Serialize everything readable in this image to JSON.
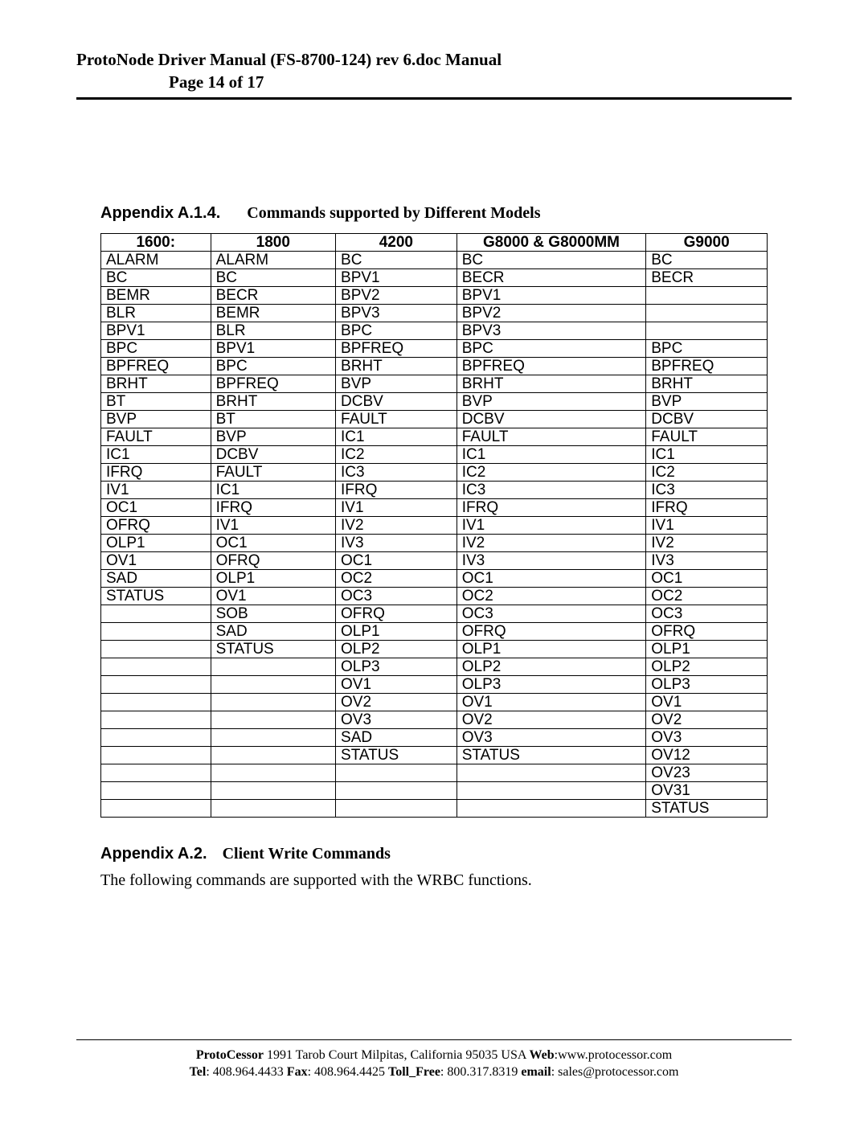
{
  "header": {
    "line1": "ProtoNode Driver Manual (FS-8700-124) rev 6.doc Manual",
    "line2": "Page 14 of 17"
  },
  "section1": {
    "number": "Appendix A.1.4.",
    "title": "Commands supported by Different Models"
  },
  "table": {
    "headers": [
      "1600:",
      "1800",
      "4200",
      "G8000 & G8000MM",
      "G9000"
    ],
    "rows": [
      [
        "ALARM",
        "ALARM",
        "BC",
        "BC",
        "BC"
      ],
      [
        "BC",
        "BC",
        "BPV1",
        "BECR",
        "BECR"
      ],
      [
        "BEMR",
        "BECR",
        "BPV2",
        "BPV1",
        ""
      ],
      [
        "BLR",
        "BEMR",
        "BPV3",
        "BPV2",
        ""
      ],
      [
        "BPV1",
        "BLR",
        "BPC",
        "BPV3",
        ""
      ],
      [
        "BPC",
        "BPV1",
        "BPFREQ",
        "BPC",
        "BPC"
      ],
      [
        "BPFREQ",
        "BPC",
        "BRHT",
        "BPFREQ",
        "BPFREQ"
      ],
      [
        "BRHT",
        "BPFREQ",
        "BVP",
        "BRHT",
        "BRHT"
      ],
      [
        "BT",
        "BRHT",
        "DCBV",
        "BVP",
        "BVP"
      ],
      [
        "BVP",
        "BT",
        "FAULT",
        "DCBV",
        "DCBV"
      ],
      [
        "FAULT",
        "BVP",
        "IC1",
        "FAULT",
        "FAULT"
      ],
      [
        "IC1",
        "DCBV",
        "IC2",
        "IC1",
        "IC1"
      ],
      [
        "IFRQ",
        "FAULT",
        "IC3",
        "IC2",
        "IC2"
      ],
      [
        "IV1",
        "IC1",
        "IFRQ",
        "IC3",
        "IC3"
      ],
      [
        "OC1",
        "IFRQ",
        "IV1",
        "IFRQ",
        "IFRQ"
      ],
      [
        "OFRQ",
        "IV1",
        "IV2",
        "IV1",
        "IV1"
      ],
      [
        "OLP1",
        "OC1",
        "IV3",
        "IV2",
        "IV2"
      ],
      [
        "OV1",
        "OFRQ",
        "OC1",
        "IV3",
        "IV3"
      ],
      [
        "SAD",
        "OLP1",
        "OC2",
        "OC1",
        "OC1"
      ],
      [
        "STATUS",
        "OV1",
        "OC3",
        "OC2",
        "OC2"
      ],
      [
        "",
        "SOB",
        "OFRQ",
        "OC3",
        "OC3"
      ],
      [
        "",
        "SAD",
        "OLP1",
        "OFRQ",
        "OFRQ"
      ],
      [
        "",
        "STATUS",
        "OLP2",
        "OLP1",
        "OLP1"
      ],
      [
        "",
        "",
        "OLP3",
        "OLP2",
        "OLP2"
      ],
      [
        "",
        "",
        "OV1",
        "OLP3",
        "OLP3"
      ],
      [
        "",
        "",
        "OV2",
        "OV1",
        "OV1"
      ],
      [
        "",
        "",
        "OV3",
        "OV2",
        "OV2"
      ],
      [
        "",
        "",
        "SAD",
        "OV3",
        "OV3"
      ],
      [
        "",
        "",
        "STATUS",
        "STATUS",
        "OV12"
      ],
      [
        "",
        "",
        "",
        "",
        "OV23"
      ],
      [
        "",
        "",
        "",
        "",
        "OV31"
      ],
      [
        "",
        "",
        "",
        "",
        "STATUS"
      ]
    ]
  },
  "section2": {
    "number": "Appendix A.2.",
    "title": "Client Write Commands",
    "body": "The following commands are supported with the WRBC functions."
  },
  "footer": {
    "company": "ProtoCessor",
    "address": " 1991 Tarob Court Milpitas, California 95035 USA  ",
    "web_label": "Web",
    "web_value": ":www.protocessor.com",
    "tel_label": "Tel",
    "tel_value": ": 408.964.4433  ",
    "fax_label": "Fax",
    "fax_value": ": 408.964.4425  ",
    "tollfree_label": "Toll_Free",
    "tollfree_value": ": 800.317.8319  ",
    "email_label": "email",
    "email_value": ": sales@protocessor.com"
  }
}
